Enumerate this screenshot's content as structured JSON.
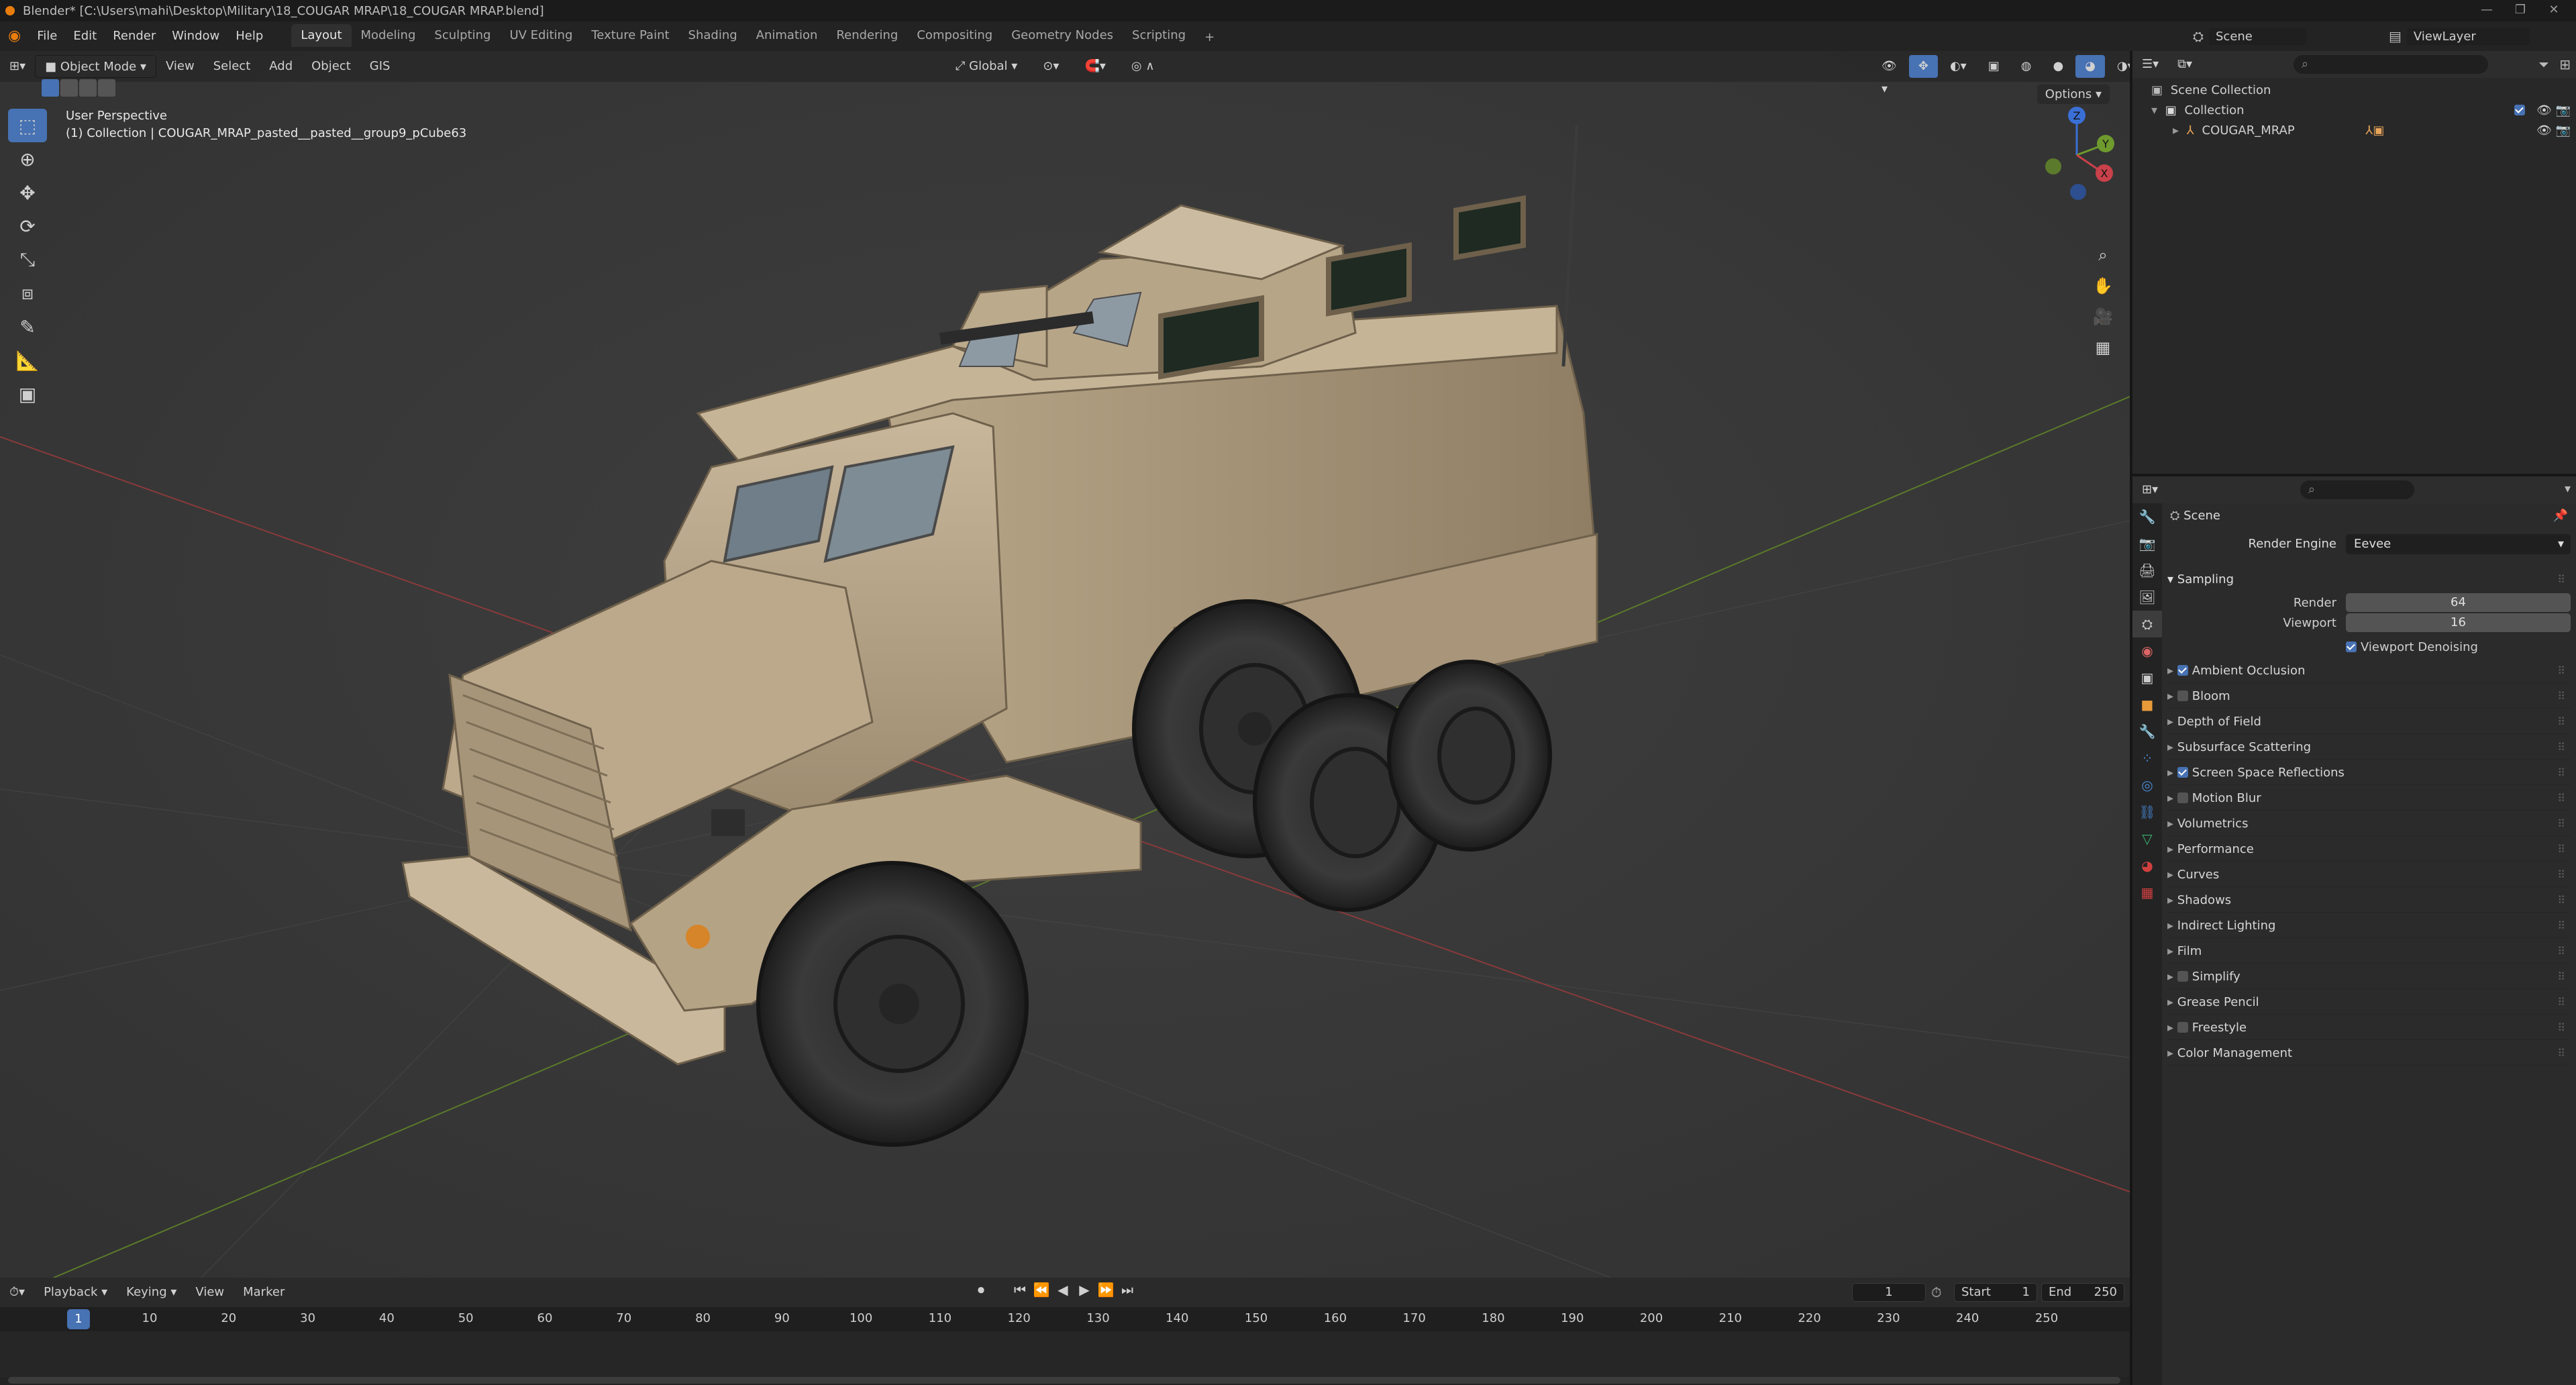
{
  "window": {
    "title": "Blender* [C:\\Users\\mahi\\Desktop\\Military\\18_COUGAR MRAP\\18_COUGAR MRAP.blend]"
  },
  "menu": {
    "items": [
      "File",
      "Edit",
      "Render",
      "Window",
      "Help"
    ]
  },
  "workspaces": {
    "tabs": [
      "Layout",
      "Modeling",
      "Sculpting",
      "UV Editing",
      "Texture Paint",
      "Shading",
      "Animation",
      "Rendering",
      "Compositing",
      "Geometry Nodes",
      "Scripting"
    ],
    "active": "Layout",
    "add": "+"
  },
  "scene_selector": {
    "label": "Scene",
    "viewlayer": "ViewLayer"
  },
  "viewport": {
    "mode": "Object Mode",
    "menus": [
      "View",
      "Select",
      "Add",
      "Object",
      "GIS"
    ],
    "orientation": "Global",
    "options": "Options",
    "overlay_line1": "User Perspective",
    "overlay_line2": "(1) Collection | COUGAR_MRAP_pasted__pasted__group9_pCube63",
    "gizmo": {
      "x": "X",
      "y": "Y",
      "z": "Z"
    }
  },
  "timeline": {
    "menus": [
      "Playback",
      "Keying",
      "View",
      "Marker"
    ],
    "current_frame": "1",
    "start_label": "Start",
    "start": "1",
    "end_label": "End",
    "end": "250",
    "ticks": [
      "10",
      "20",
      "30",
      "40",
      "50",
      "60",
      "70",
      "80",
      "90",
      "100",
      "110",
      "120",
      "130",
      "140",
      "150",
      "160",
      "170",
      "180",
      "190",
      "200",
      "210",
      "220",
      "230",
      "240",
      "250"
    ],
    "playhead": "1"
  },
  "outliner": {
    "scene_collection": "Scene Collection",
    "collection": "Collection",
    "object": "COUGAR_MRAP"
  },
  "properties": {
    "context": "Scene",
    "render_engine_label": "Render Engine",
    "render_engine": "Eevee",
    "sampling": {
      "title": "Sampling",
      "render_label": "Render",
      "render": "64",
      "viewport_label": "Viewport",
      "viewport": "16",
      "denoise": "Viewport Denoising"
    },
    "sections": [
      {
        "label": "Ambient Occlusion",
        "checkbox": true,
        "checked": true
      },
      {
        "label": "Bloom",
        "checkbox": true,
        "checked": false
      },
      {
        "label": "Depth of Field",
        "checkbox": false,
        "checked": false
      },
      {
        "label": "Subsurface Scattering",
        "checkbox": false,
        "checked": false
      },
      {
        "label": "Screen Space Reflections",
        "checkbox": true,
        "checked": true
      },
      {
        "label": "Motion Blur",
        "checkbox": true,
        "checked": false
      },
      {
        "label": "Volumetrics",
        "checkbox": false,
        "checked": false
      },
      {
        "label": "Performance",
        "checkbox": false,
        "checked": false
      },
      {
        "label": "Curves",
        "checkbox": false,
        "checked": false
      },
      {
        "label": "Shadows",
        "checkbox": false,
        "checked": false
      },
      {
        "label": "Indirect Lighting",
        "checkbox": false,
        "checked": false
      },
      {
        "label": "Film",
        "checkbox": false,
        "checked": false
      },
      {
        "label": "Simplify",
        "checkbox": true,
        "checked": false
      },
      {
        "label": "Grease Pencil",
        "checkbox": false,
        "checked": false
      },
      {
        "label": "Freestyle",
        "checkbox": true,
        "checked": false
      },
      {
        "label": "Color Management",
        "checkbox": false,
        "checked": false
      }
    ]
  },
  "colors": {
    "accent": "#4772b3",
    "blender_orange": "#e87d0d",
    "viewport_bg": "#3b3b3b",
    "vehicle_tan": "#b9a68a"
  }
}
